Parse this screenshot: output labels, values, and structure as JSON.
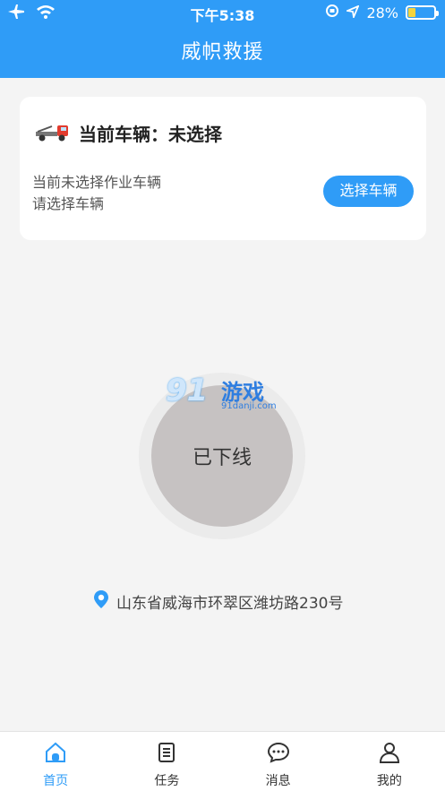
{
  "status_bar": {
    "time": "下午5:38",
    "battery_percent": "28%",
    "battery_level": 0.28
  },
  "header": {
    "title": "威帜救援"
  },
  "vehicle_card": {
    "title": "当前车辆：未选择",
    "description_line1": "当前未选择作业车辆",
    "description_line2": "请选择车辆",
    "select_button": "选择车辆",
    "icon": "tow-truck-icon"
  },
  "status_circle": {
    "label": "已下线"
  },
  "watermark": {
    "brand_number": "91",
    "brand_text": "游戏",
    "url": "91danji.com"
  },
  "location": {
    "address": "山东省威海市环翠区潍坊路230号",
    "icon": "location-pin-icon"
  },
  "tabs": [
    {
      "label": "首页",
      "icon": "home-icon",
      "active": true
    },
    {
      "label": "任务",
      "icon": "task-list-icon",
      "active": false
    },
    {
      "label": "消息",
      "icon": "message-icon",
      "active": false
    },
    {
      "label": "我的",
      "icon": "user-icon",
      "active": false
    }
  ],
  "colors": {
    "accent": "#2f9cf7",
    "offline_circle": "#c6c2c2",
    "battery": "#f5d33b"
  }
}
